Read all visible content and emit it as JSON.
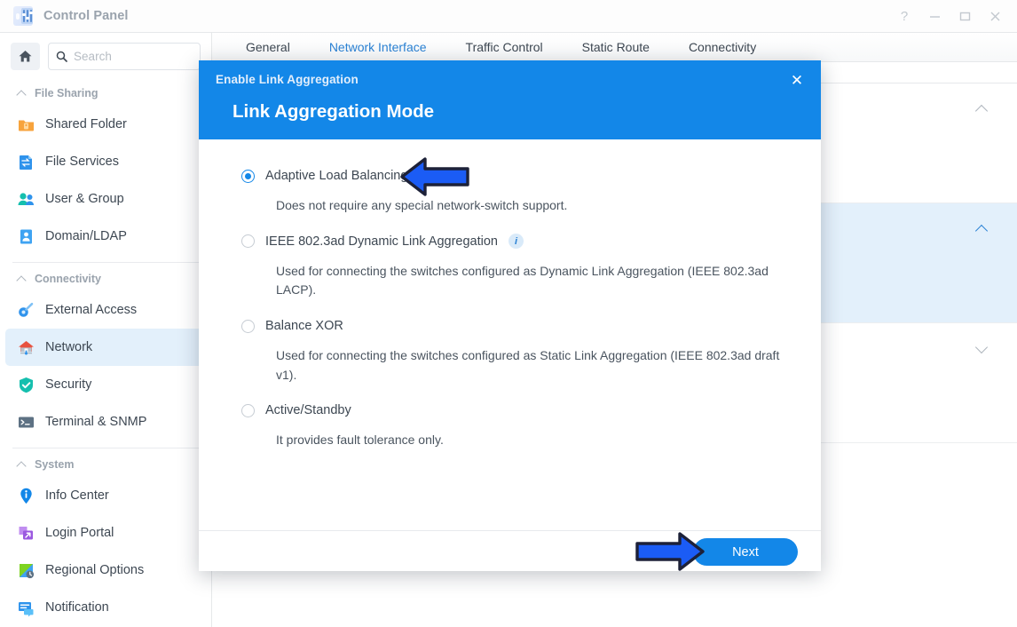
{
  "window": {
    "app_title": "Control Panel",
    "app_icon": "control-panel-icon",
    "controls": {
      "help": "?",
      "minimize": "minimize-icon",
      "maximize": "maximize-icon",
      "close": "close-icon"
    }
  },
  "sidebar": {
    "home_icon": "home-icon",
    "search": {
      "placeholder": "Search",
      "value": "",
      "icon": "search-icon"
    },
    "groups": [
      {
        "label": "File Sharing",
        "chevron": "chevron-up-icon",
        "items": [
          {
            "label": "Shared Folder",
            "icon": "shared-folder-icon"
          },
          {
            "label": "File Services",
            "icon": "file-services-icon"
          },
          {
            "label": "User & Group",
            "icon": "user-group-icon"
          },
          {
            "label": "Domain/LDAP",
            "icon": "domain-ldap-icon"
          }
        ]
      },
      {
        "label": "Connectivity",
        "chevron": "chevron-up-icon",
        "items": [
          {
            "label": "External Access",
            "icon": "external-access-icon"
          },
          {
            "label": "Network",
            "icon": "network-icon",
            "active": true
          },
          {
            "label": "Security",
            "icon": "security-icon"
          },
          {
            "label": "Terminal & SNMP",
            "icon": "terminal-snmp-icon"
          }
        ]
      },
      {
        "label": "System",
        "chevron": "chevron-up-icon",
        "items": [
          {
            "label": "Info Center",
            "icon": "info-center-icon"
          },
          {
            "label": "Login Portal",
            "icon": "login-portal-icon"
          },
          {
            "label": "Regional Options",
            "icon": "regional-options-icon"
          },
          {
            "label": "Notification",
            "icon": "notification-icon"
          }
        ]
      }
    ]
  },
  "main": {
    "tabs": [
      {
        "label": "General",
        "active": false
      },
      {
        "label": "Network Interface",
        "active": true
      },
      {
        "label": "Traffic Control",
        "active": false
      },
      {
        "label": "Static Route",
        "active": false
      },
      {
        "label": "Connectivity",
        "active": false
      }
    ]
  },
  "dialog": {
    "subtitle": "Enable Link Aggregation",
    "title": "Link Aggregation Mode",
    "close_label": "✕",
    "options": [
      {
        "label": "Adaptive Load Balancing",
        "selected": true,
        "info": false,
        "description": "Does not require any special network-switch support."
      },
      {
        "label": "IEEE 802.3ad Dynamic Link Aggregation",
        "selected": false,
        "info": true,
        "info_label": "i",
        "description": "Used for connecting the switches configured as Dynamic Link Aggregation (IEEE 802.3ad LACP)."
      },
      {
        "label": "Balance XOR",
        "selected": false,
        "info": false,
        "description": "Used for connecting the switches configured as Static Link Aggregation (IEEE 802.3ad draft v1)."
      },
      {
        "label": "Active/Standby",
        "selected": false,
        "info": false,
        "description": "It provides fault tolerance only."
      }
    ],
    "next_label": "Next"
  },
  "annotations": [
    {
      "name": "arrow-pointing-to-adaptive-load-balancing",
      "direction": "left"
    },
    {
      "name": "arrow-pointing-to-next-button",
      "direction": "right"
    }
  ],
  "colors": {
    "accent": "#1387e8",
    "tab_active": "#2b82d4",
    "sidebar_active_bg": "#e3f0fb",
    "annotation_fill": "#1b5cf5",
    "annotation_stroke": "#1d2138"
  }
}
